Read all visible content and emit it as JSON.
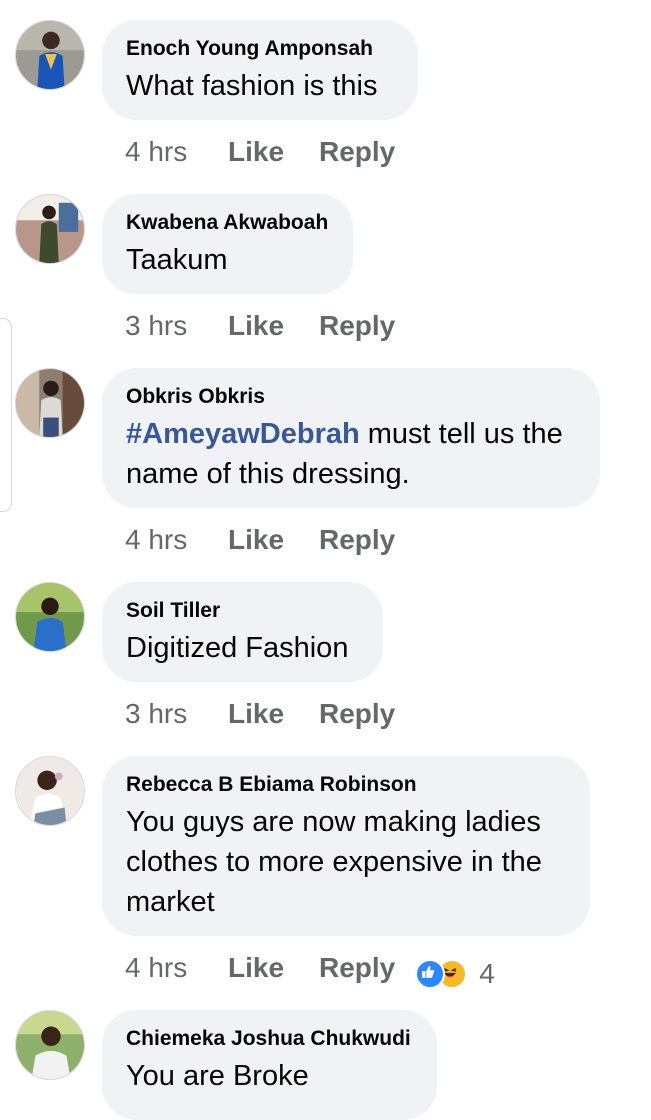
{
  "comments": [
    {
      "author": "Enoch Young Amponsah",
      "text": "What fashion is this",
      "time": "4 hrs",
      "like_label": "Like",
      "reply_label": "Reply"
    },
    {
      "author": "Kwabena Akwaboah",
      "text": "Taakum",
      "time": "3 hrs",
      "like_label": "Like",
      "reply_label": "Reply"
    },
    {
      "author": "Obkris Obkris",
      "hashtag": "#AmeyawDebrah",
      "text": " must tell us the name of this dressing.",
      "time": "4 hrs",
      "like_label": "Like",
      "reply_label": "Reply"
    },
    {
      "author": "Soil Tiller",
      "text": "Digitized Fashion",
      "time": "3 hrs",
      "like_label": "Like",
      "reply_label": "Reply"
    },
    {
      "author": "Rebecca B Ebiama Robinson",
      "text": "You guys are now making ladies clothes to more expensive in the market",
      "time": "4 hrs",
      "like_label": "Like",
      "reply_label": "Reply",
      "reactions": {
        "icons": [
          "like-reaction-icon",
          "haha-reaction-icon"
        ],
        "count": "4"
      }
    },
    {
      "author": "Chiemeka Joshua Chukwudi",
      "text": "You are Broke"
    }
  ],
  "colors": {
    "bubble_bg": "#f0f2f5",
    "meta_text": "#65676b",
    "hashtag": "#385898",
    "like_reaction": "#2d88ff",
    "haha_reaction": "#f7b928"
  }
}
